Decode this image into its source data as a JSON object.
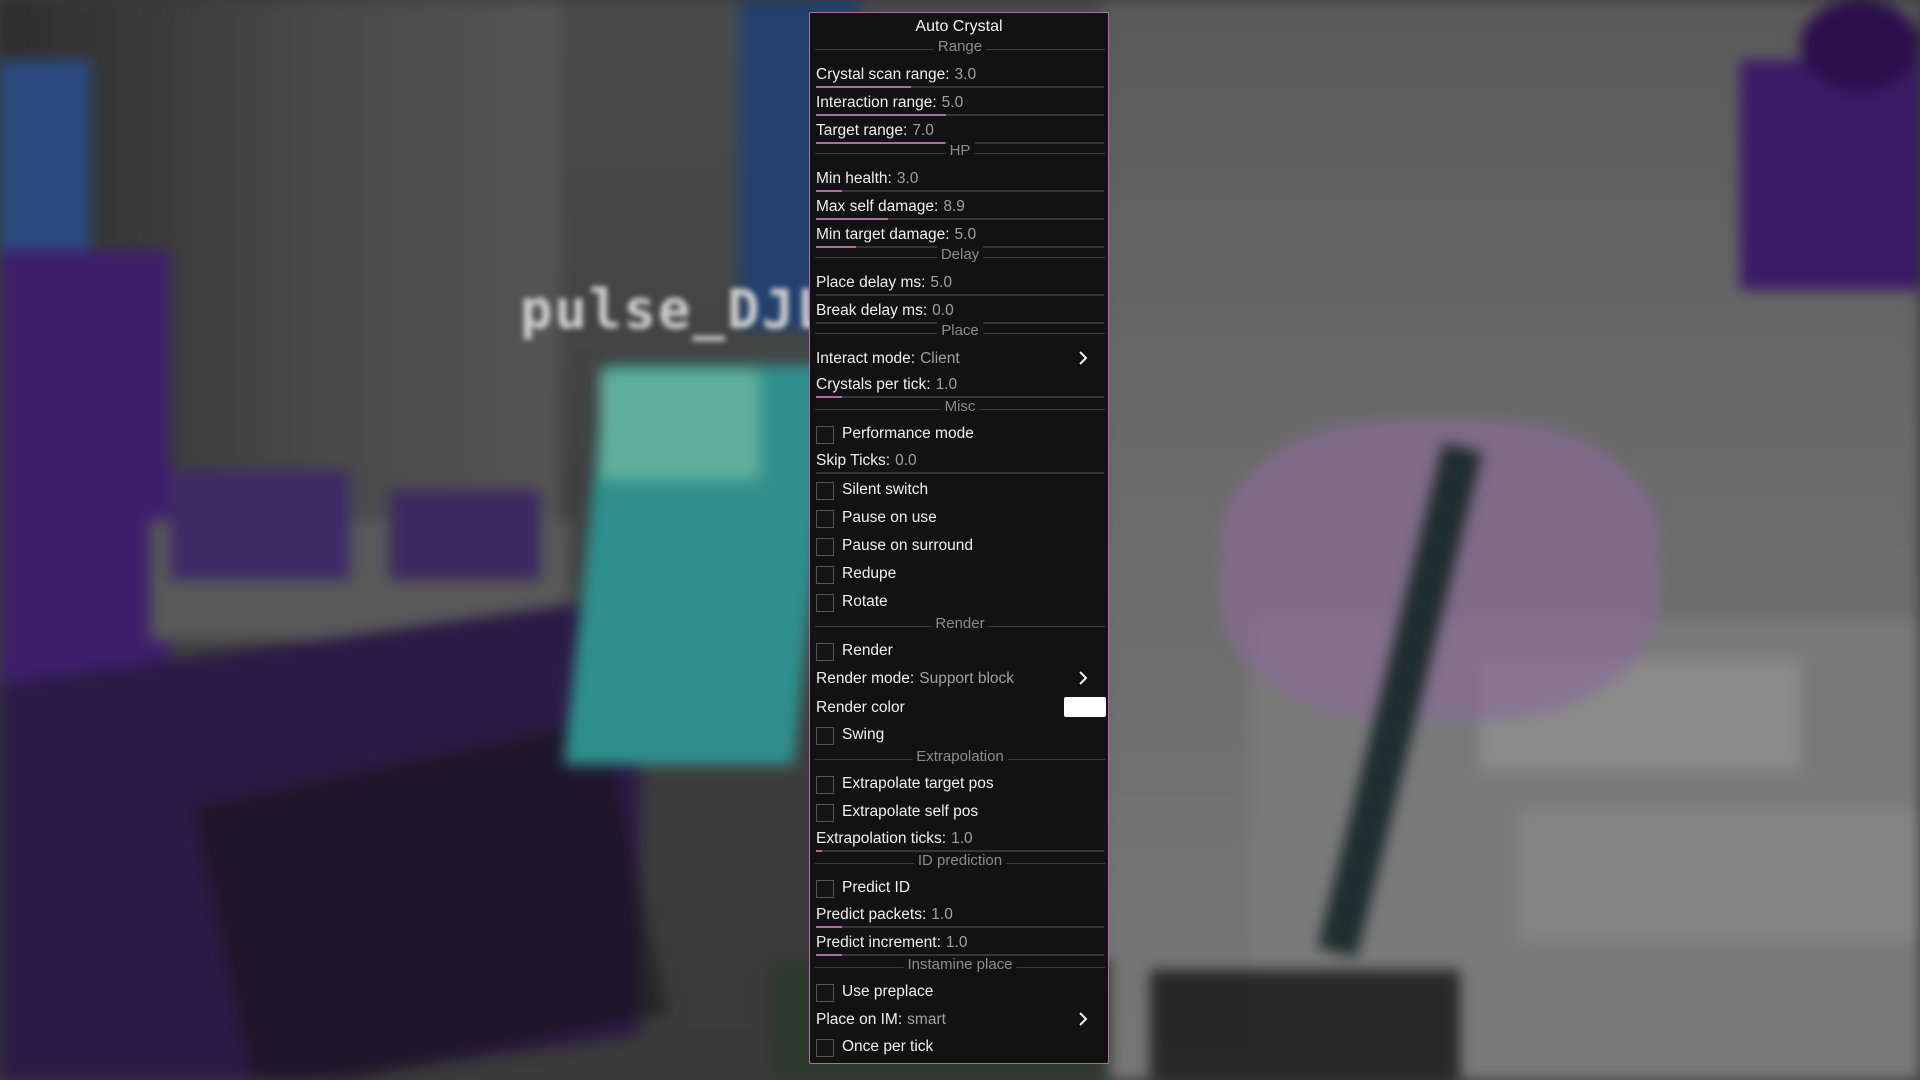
{
  "hud": {
    "nametag": "pulse_DJL"
  },
  "panel": {
    "title": "Auto Crystal",
    "accent_color": "#b06ba6",
    "sections": {
      "range": "Range",
      "hp": "HP",
      "delay": "Delay",
      "place": "Place",
      "misc": "Misc",
      "render": "Render",
      "extrapolation": "Extrapolation",
      "id_prediction": "ID prediction",
      "instamine_place": "Instamine place"
    },
    "settings": {
      "crystal_scan_range": {
        "label": "Crystal scan range:",
        "value": "3.0",
        "fill": 0.33
      },
      "interaction_range": {
        "label": "Interaction range:",
        "value": "5.0",
        "fill": 0.45
      },
      "target_range": {
        "label": "Target range:",
        "value": "7.0",
        "fill": 0.48
      },
      "min_health": {
        "label": "Min health:",
        "value": "3.0",
        "fill": 0.09
      },
      "max_self_damage": {
        "label": "Max self damage:",
        "value": "8.9",
        "fill": 0.25
      },
      "min_target_damage": {
        "label": "Min target damage:",
        "value": "5.0",
        "fill": 0.14
      },
      "place_delay_ms": {
        "label": "Place delay ms:",
        "value": "5.0",
        "fill": 0.0
      },
      "break_delay_ms": {
        "label": "Break delay ms:",
        "value": "0.0",
        "fill": 0.0
      },
      "interact_mode": {
        "label": "Interact mode:",
        "value": "Client",
        "icon": "chevron-right-icon"
      },
      "crystals_per_tick": {
        "label": "Crystals per tick:",
        "value": "1.0",
        "fill": 0.09
      },
      "performance_mode": {
        "label": "Performance mode",
        "checked": false
      },
      "skip_ticks": {
        "label": "Skip Ticks:",
        "value": "0.0",
        "fill": 0.0
      },
      "silent_switch": {
        "label": "Silent switch",
        "checked": false
      },
      "pause_on_use": {
        "label": "Pause on use",
        "checked": false
      },
      "pause_on_surround": {
        "label": "Pause on surround",
        "checked": false
      },
      "redupe": {
        "label": "Redupe",
        "checked": false
      },
      "rotate": {
        "label": "Rotate",
        "checked": false
      },
      "render": {
        "label": "Render",
        "checked": false
      },
      "render_mode": {
        "label": "Render mode:",
        "value": "Support block",
        "icon": "chevron-right-icon"
      },
      "render_color": {
        "label": "Render color",
        "color": "#ffffff"
      },
      "swing": {
        "label": "Swing",
        "checked": false
      },
      "extrapolate_target_pos": {
        "label": "Extrapolate target pos",
        "checked": false
      },
      "extrapolate_self_pos": {
        "label": "Extrapolate self pos",
        "checked": false
      },
      "extrapolation_ticks": {
        "label": "Extrapolation ticks:",
        "value": "1.0",
        "fill": 0.02
      },
      "predict_id": {
        "label": "Predict ID",
        "checked": false
      },
      "predict_packets": {
        "label": "Predict packets:",
        "value": "1.0",
        "fill": 0.09
      },
      "predict_increment": {
        "label": "Predict increment:",
        "value": "1.0",
        "fill": 0.09
      },
      "use_preplace": {
        "label": "Use preplace",
        "checked": false
      },
      "place_on_im": {
        "label": "Place on IM:",
        "value": "smart",
        "icon": "chevron-right-icon"
      },
      "once_per_tick": {
        "label": "Once per tick",
        "checked": false
      }
    }
  }
}
